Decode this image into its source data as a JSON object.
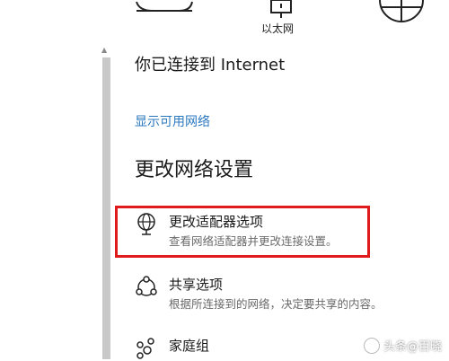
{
  "header": {
    "ethernet_label": "以太网",
    "icons": [
      "wifi-icon",
      "ethernet-icon",
      "globe-icon"
    ]
  },
  "status": {
    "connected_text": "你已连接到 Internet",
    "show_networks_link": "显示可用网络"
  },
  "section": {
    "title": "更改网络设置"
  },
  "options": [
    {
      "icon": "adapter-globe-icon",
      "title": "更改适配器选项",
      "desc": "查看网络适配器并更改连接设置。",
      "highlighted": true
    },
    {
      "icon": "sharing-icon",
      "title": "共享选项",
      "desc": "根据所连接到的网络，决定要共享的内容。",
      "highlighted": false
    },
    {
      "icon": "homegroup-icon",
      "title": "家庭组",
      "desc": "",
      "highlighted": false
    }
  ],
  "colors": {
    "link": "#2b79c0",
    "highlight_border": "#e01b1b",
    "scrollbar": "#c9c9c9"
  },
  "watermark": {
    "text": "头条@百晓"
  }
}
